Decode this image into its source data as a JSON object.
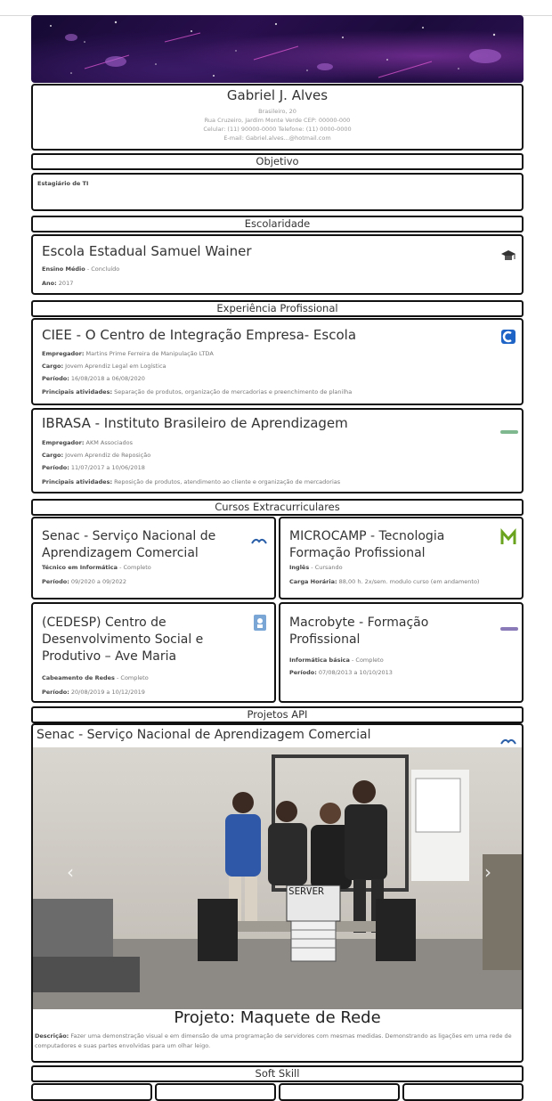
{
  "header": {
    "name": "Gabriel J. Alves",
    "details": [
      "Brasileiro, 20",
      "Rua Cruzeiro, Jardim Monte Verde CEP: 00000-000",
      "Celular: (11) 90000-0000 Telefone: (11) 0000-0000",
      "E-mail: Gabriel.alves...@hotmail.com"
    ]
  },
  "objetivo": {
    "heading": "Objetivo",
    "text": "Estagiário de TI"
  },
  "escolaridade": {
    "heading": "Escolaridade",
    "school": "Escola Estadual Samuel Wainer",
    "lines": [
      {
        "label": "Ensino Médio",
        "value": " - Concluído"
      },
      {
        "label": "Ano:",
        "value": " 2017"
      }
    ]
  },
  "experiencia": {
    "heading": "Experiência Profissional",
    "items": [
      {
        "title": "CIEE - O Centro de Integração Empresa- Escola",
        "lines": [
          {
            "label": "Empregador:",
            "value": " Martins Prime Ferreira de Manipulação LTDA"
          },
          {
            "label": "Cargo:",
            "value": " Jovem Aprendiz Legal em Logística"
          },
          {
            "label": "Período:",
            "value": " 16/08/2018 a 06/08/2020"
          },
          {
            "label": "Principais atividades:",
            "value": " Separação de produtos, organização de mercadorias e preenchimento de planilha"
          }
        ]
      },
      {
        "title": "IBRASA - Instituto Brasileiro de Aprendizagem",
        "lines": [
          {
            "label": "Empregador:",
            "value": " AKM Associados"
          },
          {
            "label": "Cargo:",
            "value": " Jovem Aprendiz de Reposição"
          },
          {
            "label": "Período:",
            "value": " 11/07/2017 a 10/06/2018"
          },
          {
            "label": "Principais atividades:",
            "value": " Reposição de produtos, atendimento ao cliente e organização de mercadorias"
          }
        ]
      }
    ]
  },
  "cursos": {
    "heading": "Cursos Extracurriculares",
    "items": [
      {
        "title_lines": [
          "Senac - Serviço Nacional de",
          "Aprendizagem Comercial"
        ],
        "lines": [
          {
            "label": "Técnico em Informática",
            "value": " - Completo"
          },
          {
            "label": "Período:",
            "value": " 09/2020 a 09/2022"
          }
        ]
      },
      {
        "title_lines": [
          "MICROCAMP - Tecnologia",
          "Formação Profissional"
        ],
        "lines": [
          {
            "label": "Inglês",
            "value": " - Cursando"
          },
          {
            "label": "Carga Horária:",
            "value": " 88,00 h. 2x/sem. modulo curso (em andamento)"
          }
        ]
      },
      {
        "title_lines": [
          "(CEDESP) Centro de",
          "Desenvolvimento Social e",
          "Produtivo – Ave Maria"
        ],
        "lines": [
          {
            "label": "Cabeamento de Redes",
            "value": " - Completo"
          },
          {
            "label": "Período:",
            "value": " 20/08/2019 a 10/12/2019"
          }
        ]
      },
      {
        "title_lines": [
          "Macrobyte - Formação",
          "Profissional"
        ],
        "lines": [
          {
            "label": "Informática básica",
            "value": " - Completo"
          },
          {
            "label": "Período:",
            "value": " 07/08/2013 a 10/10/2013"
          }
        ]
      }
    ]
  },
  "projetos": {
    "heading": "Projetos API",
    "institution": "Senac - Serviço Nacional de Aprendizagem Comercial",
    "project_title": "Projeto: Maquete de Rede",
    "sign_text": "SERVER",
    "desc_label": "Descrição:",
    "desc_text": " Fazer uma demonstração visual e em dimensão de uma programação de servidores com mesmas medidas. Demonstrando as ligações em uma rede de computadores e suas partes envolvidas para um olhar leigo."
  },
  "soft": {
    "heading": "Soft Skill"
  },
  "colors": {
    "border": "#111111",
    "banner": "#2a0f4e",
    "ciee_logo": "#1e63c6",
    "microcamp_logo": "#6aa41f"
  }
}
